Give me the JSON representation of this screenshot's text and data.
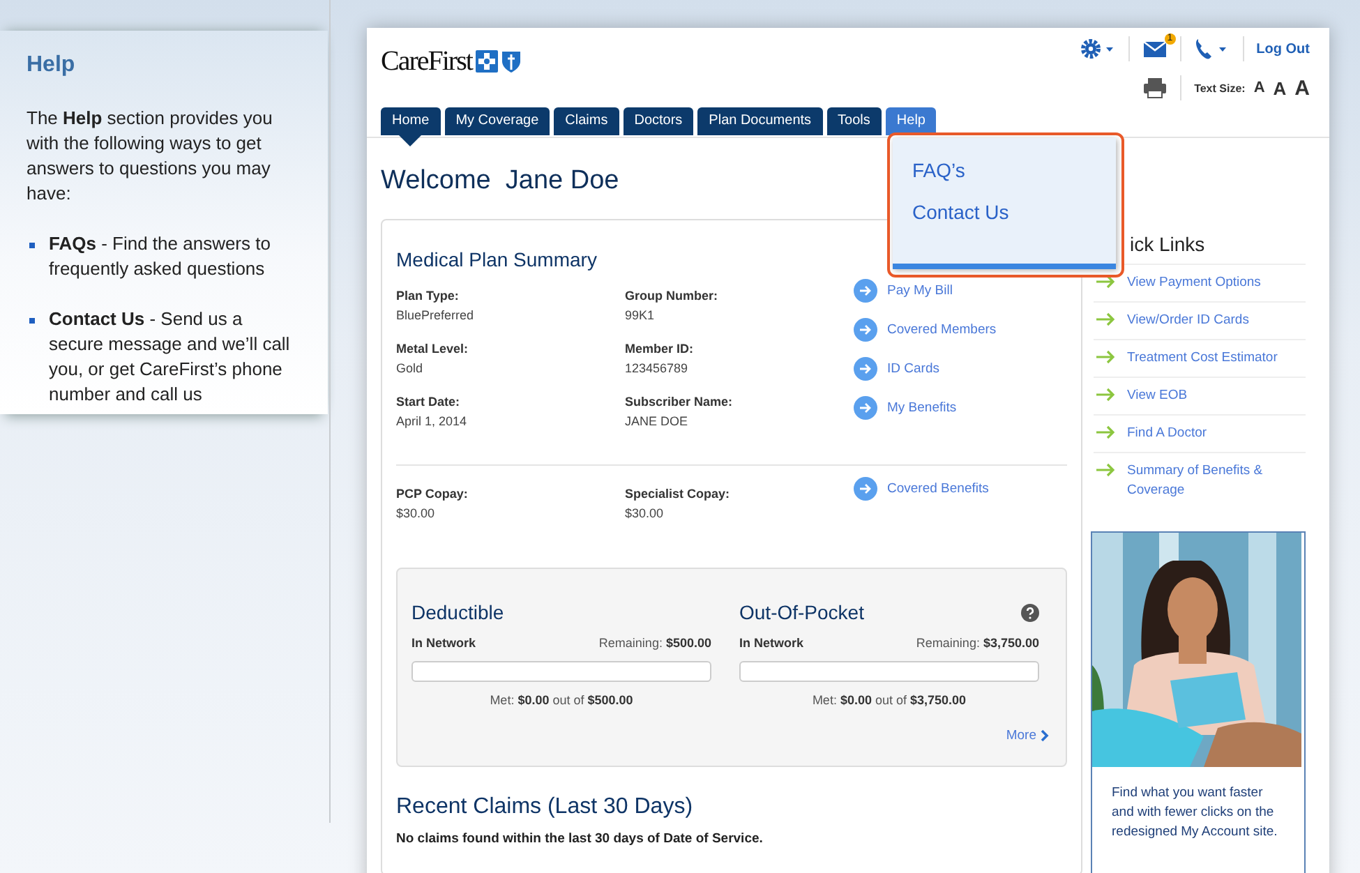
{
  "help_panel": {
    "title": "Help",
    "intro": "The **Help** section provides you with the following ways to get answers to questions you may have:",
    "items": [
      {
        "text": "**FAQs** - Find the answers to frequently asked questions"
      },
      {
        "text": "**Contact Us** - Send us a secure message and we’ll call you, or get CareFirst’s phone number and call us"
      }
    ]
  },
  "header": {
    "logo": "CareFirst",
    "mail_count": "1",
    "logout": "Log Out",
    "text_size_label": "Text Size:",
    "text_sizes": [
      "A",
      "A",
      "A"
    ]
  },
  "tabs": [
    {
      "label": "Home",
      "selected": true,
      "open": false
    },
    {
      "label": "My Coverage",
      "selected": false,
      "open": false
    },
    {
      "label": "Claims",
      "selected": false,
      "open": false
    },
    {
      "label": "Doctors",
      "selected": false,
      "open": false
    },
    {
      "label": "Plan Documents",
      "selected": false,
      "open": false
    },
    {
      "label": "Tools",
      "selected": false,
      "open": false
    },
    {
      "label": "Help",
      "selected": false,
      "open": true
    }
  ],
  "help_menu": {
    "items": [
      "FAQ’s",
      "Contact Us"
    ]
  },
  "welcome": {
    "label": "Welcome",
    "name": "Jane Doe"
  },
  "plan_summary": {
    "title": "Medical Plan Summary",
    "fields": [
      {
        "label": "Plan Type:",
        "value": "BluePreferred"
      },
      {
        "label": "Group Number:",
        "value": "99K1"
      },
      {
        "label": "Metal Level:",
        "value": "Gold"
      },
      {
        "label": "Member ID:",
        "value": "123456789"
      },
      {
        "label": "Start Date:",
        "value": "April 1, 2014"
      },
      {
        "label": "Subscriber Name:",
        "value": "JANE DOE"
      }
    ],
    "links": [
      "Pay My Bill",
      "Covered Members",
      "ID Cards",
      "My Benefits"
    ],
    "copays": [
      {
        "label": "PCP Copay:",
        "value": "$30.00"
      },
      {
        "label": "Specialist Copay:",
        "value": "$30.00"
      }
    ],
    "copay_links": [
      "Covered Benefits"
    ]
  },
  "accumulators": [
    {
      "title": "Deductible",
      "network": "In Network",
      "remaining_label": "Remaining:",
      "remaining": "$500.00",
      "level": 0,
      "met_label": "Met:",
      "met": "$0.00",
      "out_of": "out of",
      "total": "$500.00",
      "help": false
    },
    {
      "title": "Out-Of-Pocket",
      "network": "In Network",
      "remaining_label": "Remaining:",
      "remaining": "$3,750.00",
      "level": 0,
      "met_label": "Met:",
      "met": "$0.00",
      "out_of": "out of",
      "total": "$3,750.00",
      "help": true
    }
  ],
  "more": "More",
  "claims": {
    "title": "Recent Claims (Last 30 Days)",
    "message": "No claims found within the last 30 days of Date of Service."
  },
  "quick_links": {
    "title": "ick Links",
    "items": [
      "View Payment Options",
      "View/Order ID Cards",
      "Treatment Cost Estimator",
      "View EOB",
      "Find A Doctor",
      "Summary of Benefits & Coverage"
    ]
  },
  "promo": {
    "text": "Find what you want faster and with fewer clicks on the redesigned My Account site."
  }
}
